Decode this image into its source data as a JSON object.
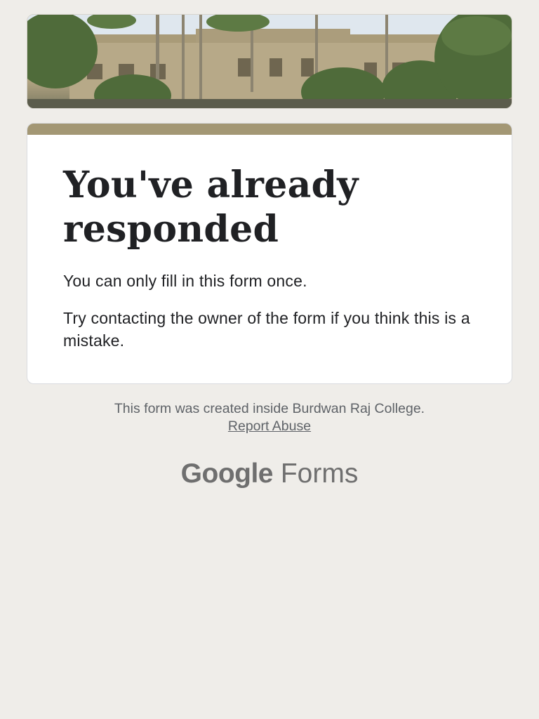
{
  "card": {
    "title": "You've already responded",
    "line1": "You can only fill in this form once.",
    "line2": "Try contacting the owner of the form if you think this is a mistake."
  },
  "footer": {
    "created_text": "This form was created inside Burdwan Raj College.",
    "report_label": "Report Abuse"
  },
  "brand": {
    "google": "Google",
    "forms": "Forms"
  },
  "colors": {
    "accent": "#a39774",
    "background": "#efede9"
  }
}
